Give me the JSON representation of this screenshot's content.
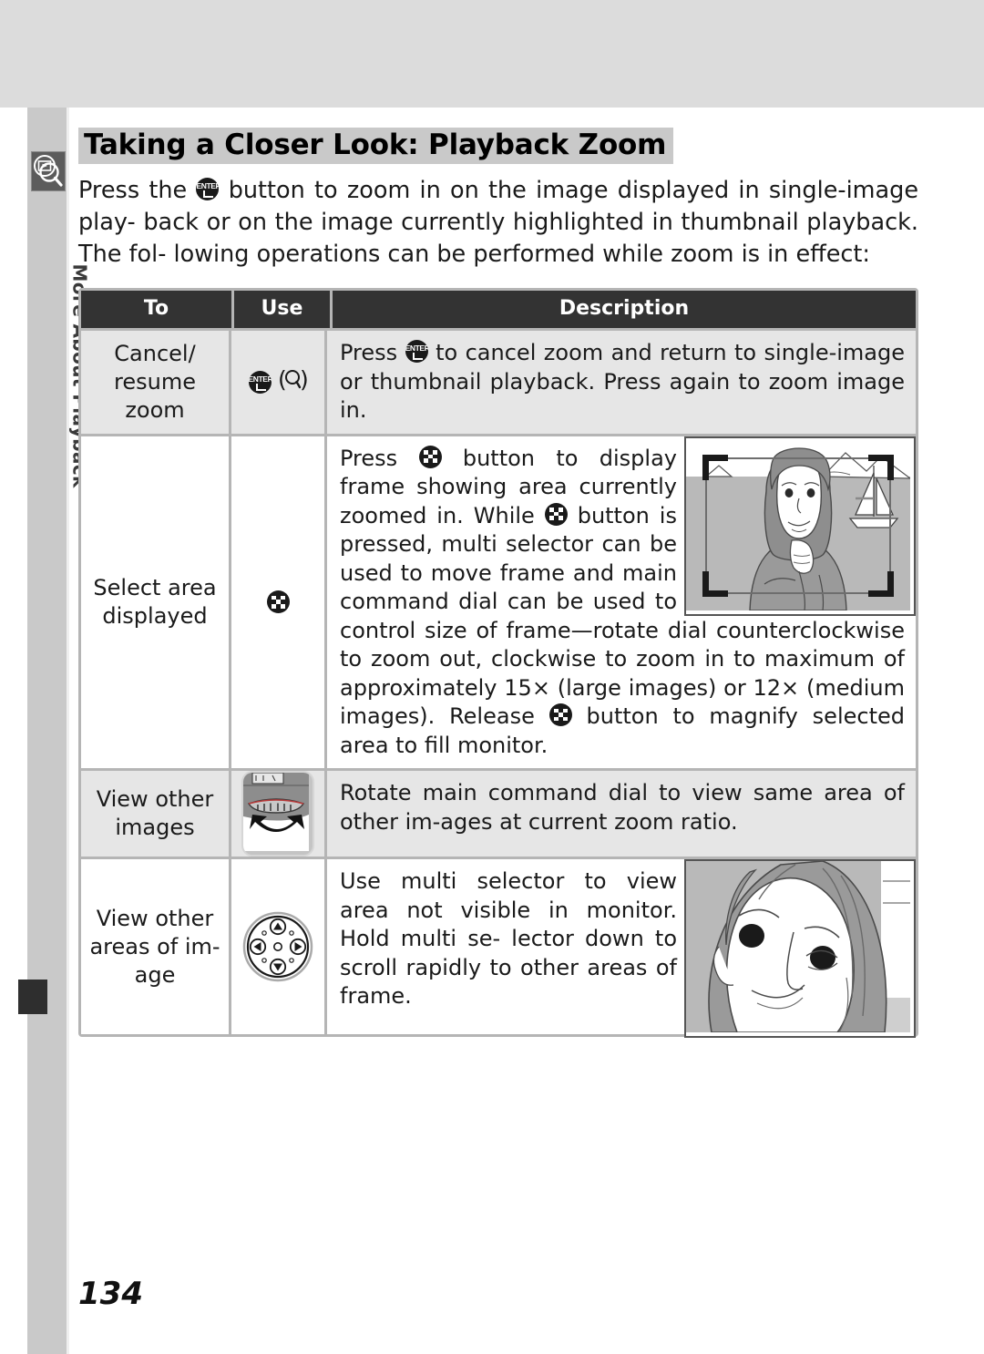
{
  "page": {
    "number": "134",
    "chapter_tab": "More About Playback",
    "tab_icon": "playback-zoom-icon"
  },
  "heading": "Taking a Closer Look: Playback Zoom",
  "intro": {
    "line1_before": "Press the",
    "line1_icon": "enter-button-icon",
    "line1_after": "button to zoom in on the image displayed in single-image play-",
    "line2": "back or on the image currently highlighted in thumbnail playback.  The fol-",
    "line3": "lowing operations can be performed while zoom is in effect:"
  },
  "table": {
    "headers": [
      "To",
      "Use",
      "Description"
    ],
    "rows": [
      {
        "to": "Cancel/\nresume zoom",
        "use_icons": [
          "enter-button-icon",
          "magnifier-paren-icon"
        ],
        "use_text": "(Q)",
        "description_parts": [
          "Press",
          "to cancel zoom and return to single-image or thumbnail playback.  Press again to zoom image in."
        ],
        "description_icon": "enter-button-icon",
        "shaded": true,
        "illustration": null
      },
      {
        "to": "Select area\ndisplayed",
        "use_icons": [
          "thumbnail-button-icon"
        ],
        "description_parts": [
          "Press",
          "button to display frame showing area currently zoomed in. While",
          "button is pressed, multi selector can be used to move frame and main command dial can be used to control size of frame—rotate dial counterclockwise to zoom out,",
          "clockwise to zoom in to maximum of approximately 15× (large images) or 12× (medium images).  Release",
          "button to magnify selected area to fill monitor."
        ],
        "description_icon": "thumbnail-button-icon",
        "shaded": false,
        "illustration": "woman-with-crop-frame"
      },
      {
        "to": "View other\nimages",
        "use_icons": [
          "main-command-dial-icon"
        ],
        "description_parts": [
          "Rotate main command dial to view same area of other im-ages at current zoom ratio."
        ],
        "shaded": true,
        "illustration": null
      },
      {
        "to": "View other\nareas of im-\nage",
        "use_icons": [
          "multi-selector-icon"
        ],
        "description_parts": [
          "Use multi selector to view area not visible in monitor.  Hold multi se-lector down to scroll rapidly to other areas of frame."
        ],
        "shaded": false,
        "illustration": "woman-face-closeup"
      }
    ]
  },
  "colors": {
    "header_bg": "#333333",
    "table_border": "#b5b5b5",
    "row_shade": "#e6e6e6",
    "rail": "#c9c9c9",
    "top_band": "#dcdcdc",
    "heading_highlight": "#c9c9c9"
  },
  "row_text": {
    "r1_to_line1": "Cancel/",
    "r1_to_line2": "resume zoom",
    "r1_desc_a": "Press",
    "r1_desc_b": "to cancel zoom and return to single-image or",
    "r1_desc_c": "thumbnail playback.  Press again to zoom image in.",
    "r2_to_line1": "Select area",
    "r2_to_line2": "displayed",
    "r2_d1": "Press",
    "r2_d2": "button to display frame",
    "r2_d3": "showing area currently zoomed in.",
    "r2_d4a": "While",
    "r2_d4b": "button is pressed, multi",
    "r2_d5": "selector can be used to move frame",
    "r2_d6": "and main command dial can be used",
    "r2_d7": "to control size of frame—rotate",
    "r2_d8": "dial counterclockwise to zoom out,",
    "r2_d9": "clockwise to zoom in to maximum of approximately 15×",
    "r2_d10a": "(large images) or 12× (medium images).  Release",
    "r2_d10b": "button",
    "r2_d11": "to magnify selected area to fill monitor.",
    "r3_to_line1": "View other",
    "r3_to_line2": "images",
    "r3_d1": "Rotate main command dial to view same area of other im-",
    "r3_d2": "ages at current zoom ratio.",
    "r4_to_line1": "View other",
    "r4_to_line2": "areas of im-",
    "r4_to_line3": "age",
    "r4_d1": "Use multi selector to view area not",
    "r4_d2": "visible in monitor.   Hold multi se-",
    "r4_d3": "lector down to scroll rapidly to other",
    "r4_d4": "areas of frame."
  }
}
